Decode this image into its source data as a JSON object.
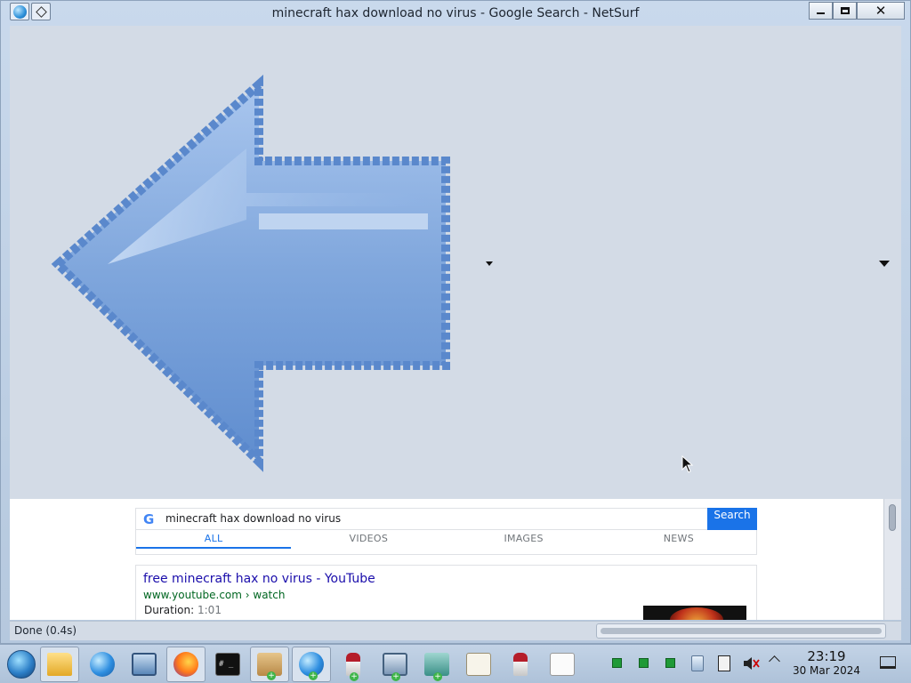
{
  "window": {
    "title": "minecraft hax download no virus - Google Search - NetSurf",
    "close_glyph": "✕"
  },
  "page": {
    "search": {
      "query": "minecraft hax download no virus",
      "button_label": "Search",
      "logo": "G"
    },
    "tabs": [
      {
        "label": "ALL",
        "active": true
      },
      {
        "label": "VIDEOS",
        "active": false
      },
      {
        "label": "IMAGES",
        "active": false
      },
      {
        "label": "NEWS",
        "active": false
      }
    ],
    "result": {
      "title": "free minecraft hax no virus - YouTube",
      "url": "www.youtube.com › watch",
      "duration_label": "Duration:",
      "duration_value": "1:01"
    }
  },
  "status": {
    "text": "Done (0.4s)"
  },
  "taskbar": {
    "apps": [
      {
        "name": "file-manager",
        "icon": "folder-icon",
        "active": true
      },
      {
        "name": "browser-globe",
        "icon": "globe-icon"
      },
      {
        "name": "system-monitor",
        "icon": "monitor-icon"
      },
      {
        "name": "firefox",
        "icon": "firefox-icon",
        "active": true
      },
      {
        "name": "terminal",
        "icon": "terminal-icon",
        "label": "# _"
      },
      {
        "name": "package-installer",
        "icon": "box-icon",
        "active": true
      },
      {
        "name": "netsurf",
        "icon": "globe-icon",
        "active": true
      },
      {
        "name": "wine-app-1",
        "icon": "wine-glass-icon"
      },
      {
        "name": "monitor-app",
        "icon": "monitor-icon"
      },
      {
        "name": "cube-app",
        "icon": "cube-icon"
      },
      {
        "name": "text-editor",
        "icon": "editor-icon"
      },
      {
        "name": "wine-app-2",
        "icon": "wine-glass-icon"
      },
      {
        "name": "document-viewer",
        "icon": "document-icon"
      }
    ],
    "clock": {
      "time": "23:19",
      "date": "30 Mar 2024"
    }
  }
}
